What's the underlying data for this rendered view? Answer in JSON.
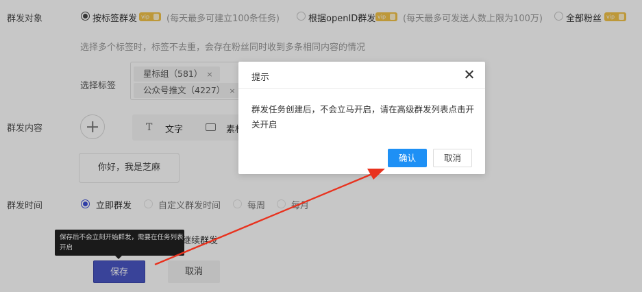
{
  "form": {
    "target_label": "群发对象",
    "target_options": [
      {
        "label": "按标签群发",
        "note": "(每天最多可建立100条任务)",
        "selected": true
      },
      {
        "label": "根据openID群发",
        "note": "(每天最多可发送人数上限为100万)",
        "selected": false
      },
      {
        "label": "全部粉丝",
        "note": "",
        "selected": false
      }
    ],
    "vip_badge": "vip",
    "tag_hint": "选择多个标签时，标签不去重，会存在粉丝同时收到多条相同内容的情况",
    "select_tags_label": "选择标签",
    "tags": [
      "星标组（581）",
      "公众号推文（4227）"
    ],
    "tag_remove": "×",
    "content_label": "群发内容",
    "content_types": [
      {
        "icon": "text-icon",
        "label": "文字"
      },
      {
        "icon": "material-icon",
        "label": "素材"
      }
    ],
    "preview_text": "你好，我是芝麻",
    "time_label": "群发时间",
    "time_options": [
      {
        "label": "立即群发",
        "selected": true
      },
      {
        "label": "自定义群发时间",
        "selected": false
      },
      {
        "label": "每周",
        "selected": false
      },
      {
        "label": "每月",
        "selected": false
      }
    ],
    "continue_label": "继续群发",
    "tooltip": "保存后不会立刻开始群发，需要在任务列表开启",
    "save_button": "保存",
    "cancel_button": "取消"
  },
  "modal": {
    "title": "提示",
    "body": "群发任务创建后，不会立马开启，请在高级群发列表点击开关开启",
    "confirm": "确认",
    "cancel": "取消"
  },
  "colors": {
    "primary": "#4a56c5",
    "modal_confirm": "#1e90f5",
    "arrow": "#e8321e",
    "vip": "#f3c34a"
  }
}
